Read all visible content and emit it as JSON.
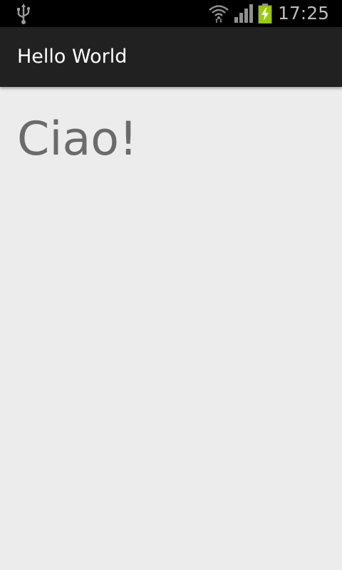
{
  "status_bar": {
    "time": "17:25",
    "icons": [
      "usb-icon",
      "wifi-icon",
      "signal-icon",
      "battery-charging-icon"
    ],
    "battery_color": "#99cc00"
  },
  "action_bar": {
    "title": "Hello World"
  },
  "content": {
    "greeting": "Ciao!"
  },
  "colors": {
    "status_bar_bg": "#000000",
    "action_bar_bg": "#212121",
    "content_bg": "#ececec",
    "greeting_text": "#6b6b6b"
  }
}
